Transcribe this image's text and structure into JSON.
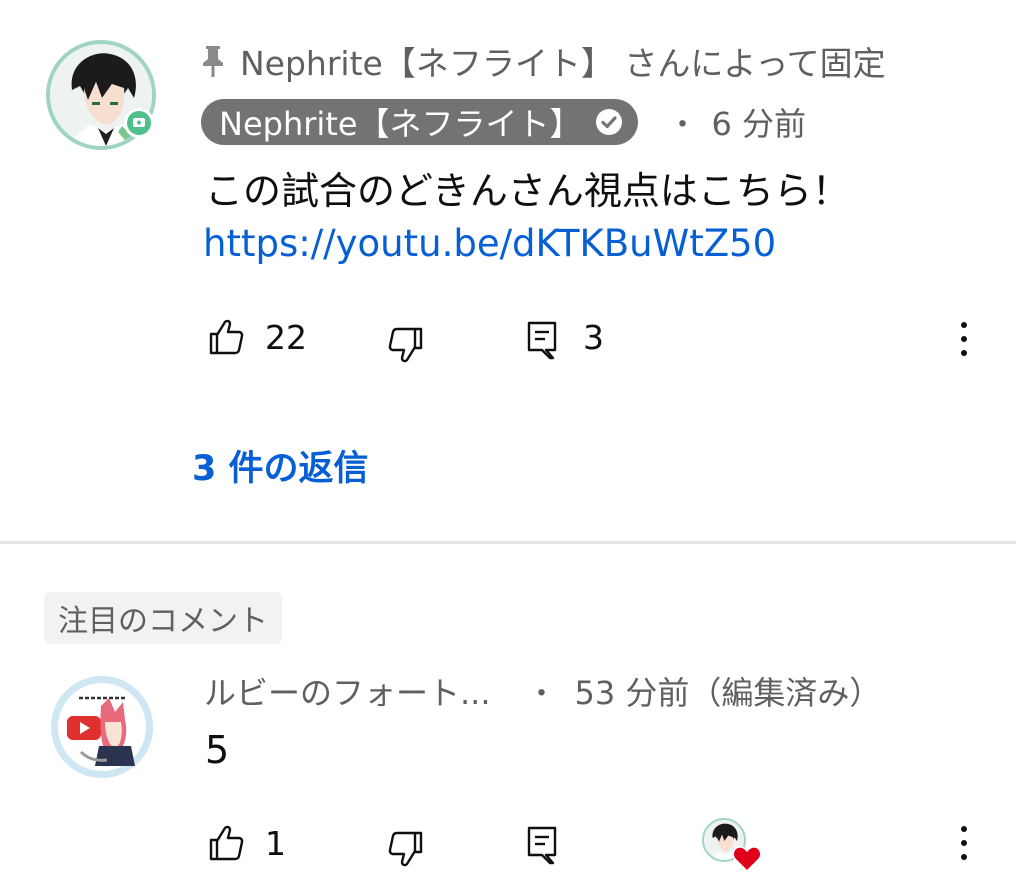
{
  "pinned_comment": {
    "pinned_label": "Nephrite【ネフライト】 さんによって固定",
    "author": "Nephrite【ネフライト】",
    "separator": "・",
    "time": "6 分前",
    "text": "この試合のどきんさん視点はこちら！",
    "link": "https://youtu.be/dKTKBuWtZ50",
    "like_count": "22",
    "reply_count": "3",
    "replies_label": "3 件の返信"
  },
  "highlighted_comment": {
    "badge": "注目のコメント",
    "author": "ルビーのフォート...",
    "separator": "・",
    "time": "53 分前（編集済み）",
    "text": "5",
    "like_count": "1"
  },
  "icons": {
    "pin": "pin-icon",
    "verified": "verified-check-icon",
    "like": "thumbs-up-icon",
    "dislike": "thumbs-down-icon",
    "reply": "reply-comment-icon",
    "more": "more-vertical-icon",
    "creator_heart": "creator-heart-icon"
  },
  "colors": {
    "link": "#065fd4",
    "secondary_text": "#606060",
    "author_chip_bg": "#737373",
    "heart": "#e0001b",
    "avatar_ring": "#9fd4c4"
  }
}
